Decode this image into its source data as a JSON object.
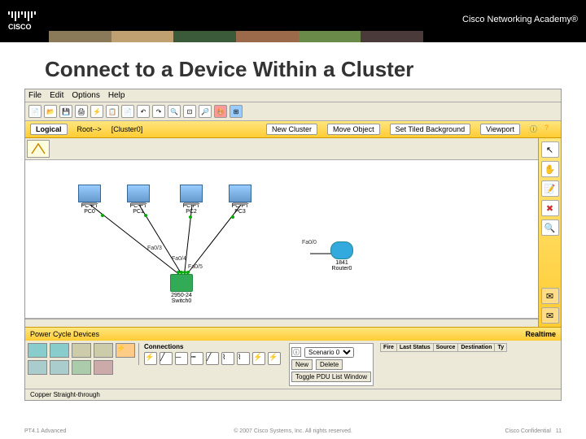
{
  "header": {
    "brand": "CISCO",
    "academy": "Cisco Networking Academy®"
  },
  "title": "Connect to a Device Within a Cluster",
  "menubar": [
    "File",
    "Edit",
    "Options",
    "Help"
  ],
  "yellowbar": {
    "logical": "Logical",
    "root": "Root-->",
    "cluster": "[Cluster0]",
    "new_cluster": "New Cluster",
    "move_object": "Move Object",
    "set_bg": "Set Tiled Background",
    "viewport": "Viewport"
  },
  "canvas": {
    "devices": {
      "pc0": {
        "type": "PC-PT",
        "name": "PC0"
      },
      "pc1": {
        "type": "PC-PT",
        "name": "PC1"
      },
      "pc2": {
        "type": "PC-PT",
        "name": "PC2"
      },
      "pc3": {
        "type": "PC-PT",
        "name": "PC3"
      },
      "switch0": {
        "type": "2950-24",
        "name": "Switch0"
      },
      "router0": {
        "type": "1841",
        "name": "Router0"
      }
    },
    "ports": {
      "fa03": "Fa0/3",
      "fa04": "Fa0/4",
      "fa05": "Fa0/5",
      "fa00": "Fa0/0"
    }
  },
  "right_tools": {
    "select": "select",
    "hand": "hand",
    "note": "note",
    "delete": "delete",
    "zoom": "zoom",
    "pdu_simple": "pdu-simple",
    "pdu_complex": "pdu-complex"
  },
  "bottom": {
    "power_cycle": "Power Cycle Devices",
    "realtime": "Realtime",
    "connections": "Connections",
    "copper": "Copper Straight-through",
    "scenario": "Scenario 0",
    "new": "New",
    "delete": "Delete",
    "toggle": "Toggle PDU List Window",
    "table_headers": [
      "Fire",
      "Last Status",
      "Source",
      "Destination",
      "Ty"
    ]
  },
  "footer": {
    "left": "PT4.1 Advanced",
    "center": "© 2007 Cisco Systems, Inc. All rights reserved.",
    "right": "Cisco Confidential",
    "page": "11"
  }
}
